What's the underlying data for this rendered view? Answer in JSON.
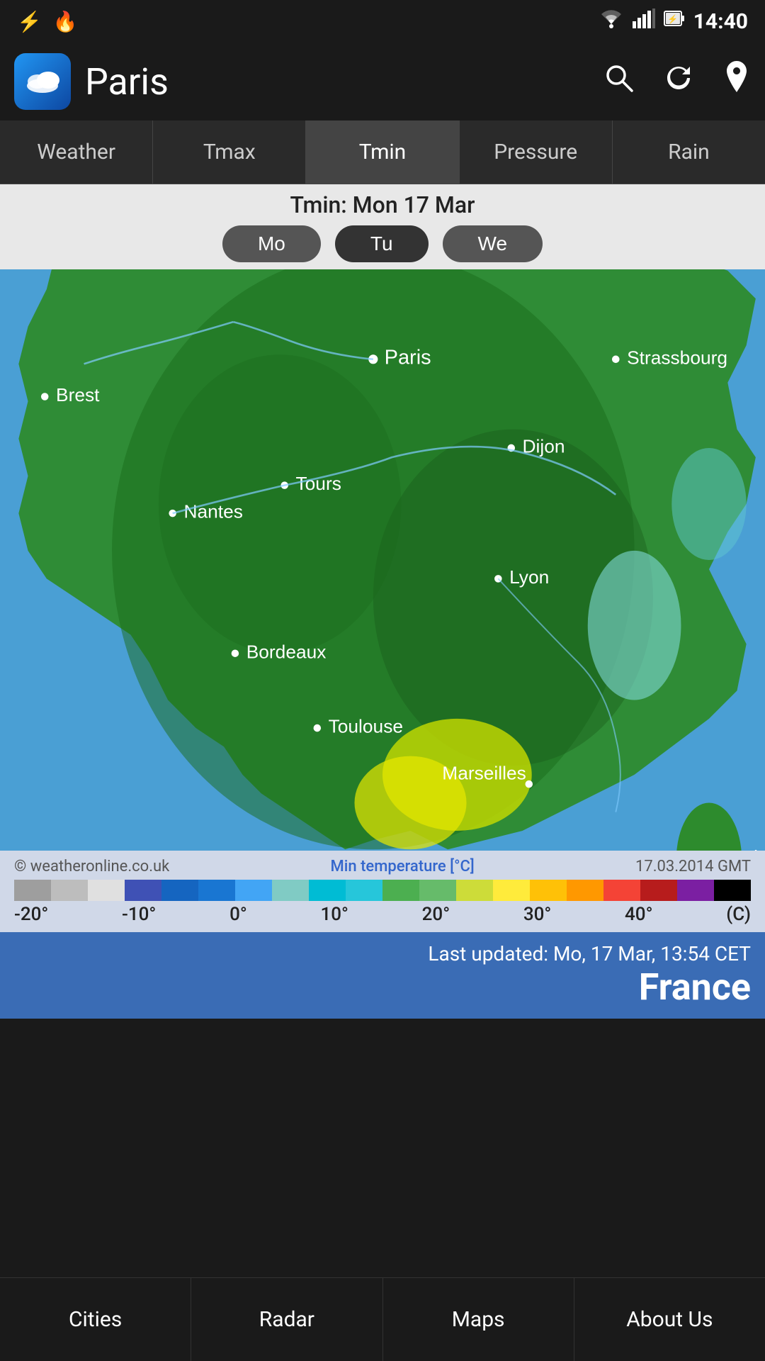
{
  "status_bar": {
    "time": "14:40",
    "usb_icon": "⚡",
    "flame_icon": "🔥"
  },
  "app_bar": {
    "city": "Paris",
    "app_icon": "☁",
    "search_label": "search",
    "refresh_label": "refresh",
    "location_label": "location"
  },
  "tabs": [
    {
      "id": "weather",
      "label": "Weather",
      "active": false
    },
    {
      "id": "tmax",
      "label": "Tmax",
      "active": false
    },
    {
      "id": "tmin",
      "label": "Tmin",
      "active": true
    },
    {
      "id": "pressure",
      "label": "Pressure",
      "active": false
    },
    {
      "id": "rain",
      "label": "Rain",
      "active": false
    }
  ],
  "date_section": {
    "label": "Tmin: Mon 17 Mar",
    "days": [
      {
        "key": "mo",
        "label": "Mo",
        "active": false
      },
      {
        "key": "tu",
        "label": "Tu",
        "active": true
      },
      {
        "key": "we",
        "label": "We",
        "active": false
      }
    ]
  },
  "legend": {
    "copyright": "© weatheronline.co.uk",
    "title": "Min temperature [°C]",
    "date": "17.03.2014  GMT",
    "temp_labels": [
      "-20°",
      "-10°",
      "0°",
      "10°",
      "20°",
      "30°",
      "40°",
      "(C)"
    ]
  },
  "info": {
    "last_updated": "Last updated: Mo, 17 Mar, 13:54 CET",
    "country": "France"
  },
  "bottom_nav": [
    {
      "id": "cities",
      "label": "Cities"
    },
    {
      "id": "radar",
      "label": "Radar"
    },
    {
      "id": "maps",
      "label": "Maps"
    },
    {
      "id": "about",
      "label": "About Us"
    }
  ]
}
